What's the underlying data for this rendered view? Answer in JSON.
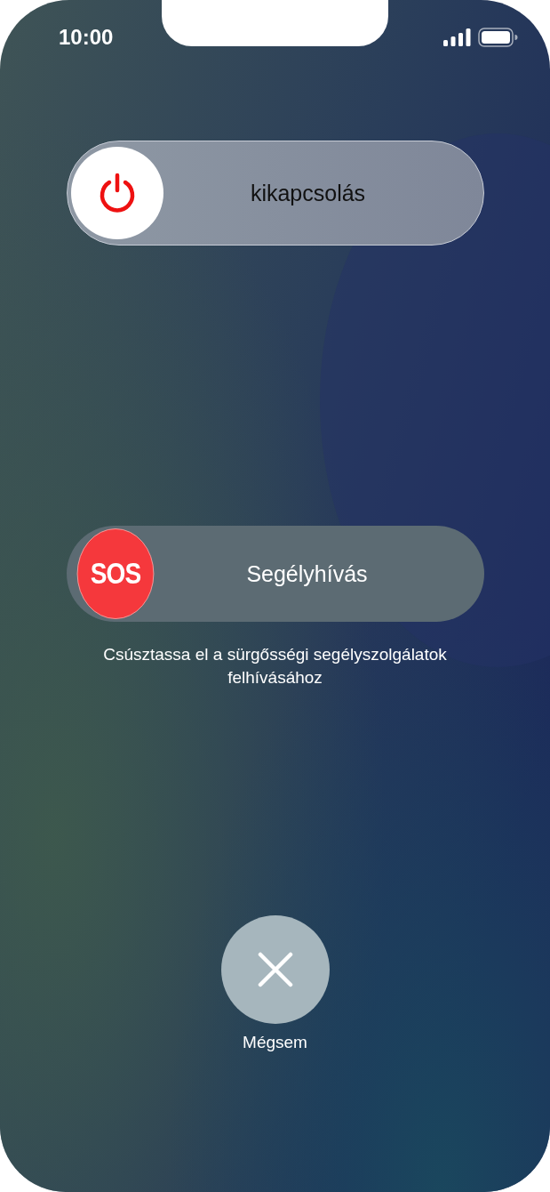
{
  "status_bar": {
    "time": "10:00"
  },
  "sliders": [
    {
      "kind": "power",
      "level": 0,
      "label": "kikapcsolás"
    },
    {
      "kind": "sos",
      "level": 0,
      "thumb_text": "SOS",
      "label": "Segélyhívás",
      "caption": "Csúsztassa el a sürgősségi segélyszolgálatok felhívásához"
    }
  ],
  "cancel": {
    "label": "Mégsem"
  }
}
